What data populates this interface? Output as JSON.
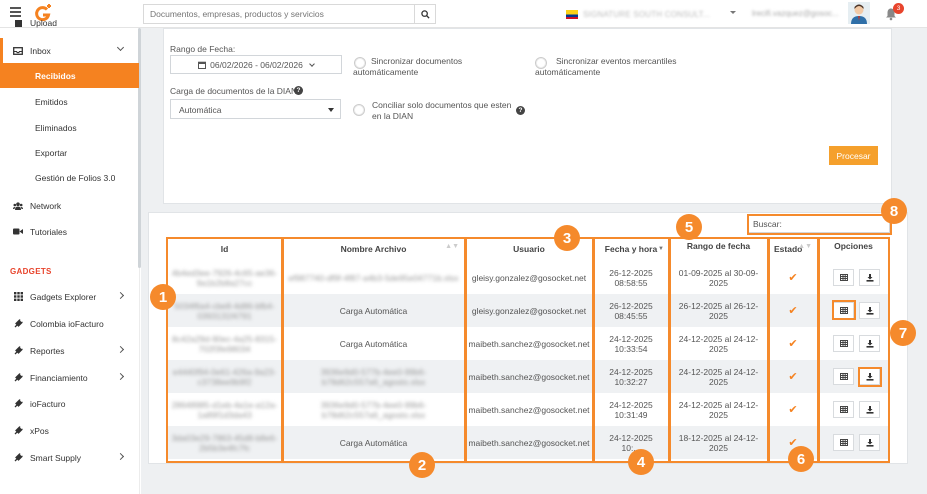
{
  "header": {
    "search_placeholder": "Documentos, empresas, productos y servicios",
    "company_name": "SIGNATURE SOUTH CONSULT...",
    "user_email": "lrecifi.vazquez@gosoc...",
    "notification_count": "3"
  },
  "sidebar": {
    "top_item_label": "Upload",
    "inbox": {
      "label": "Inbox",
      "subitems": [
        "Recibidos",
        "Emitidos",
        "Eliminados",
        "Exportar",
        "Gestión de Folios 3.0"
      ]
    },
    "items": [
      "Network",
      "Tutoriales"
    ],
    "gadgets_heading": "GADGETS",
    "gadgets": [
      "Gadgets Explorer",
      "Colombia ioFacturo",
      "Reportes",
      "Financiamiento",
      "ioFacturo",
      "xPos",
      "Smart Supply"
    ]
  },
  "form": {
    "date_range_label": "Rango de Fecha:",
    "date_range_value": "06/02/2026 - 06/02/2026",
    "sync_docs_label_1": "Sincronizar documentos",
    "sync_docs_label_2": "automáticamente",
    "sync_events_label_1": "Sincronizar eventos mercantiles",
    "sync_events_label_2": "automáticamente",
    "load_label": "Carga de documentos de la DIAN:",
    "load_value": "Automática",
    "reconcile_label_1": "Conciliar solo documentos que esten",
    "reconcile_label_2": "en la DIAN",
    "process_button": "Procesar"
  },
  "table": {
    "search_label": "Buscar:",
    "columns": [
      "Id",
      "Nombre Archivo",
      "Usuario",
      "Fecha y hora",
      "Rango de fecha",
      "Estado",
      "Opciones"
    ],
    "rows": [
      {
        "id": "4b4ed3ee-7926-4c65-ae36-9a1b2b8a27cc",
        "file_1": "ef987740-df9f-4f87-a4b3-5de95e04771b.xlsx",
        "file_2": "",
        "user": "gleisy.gonzalez@gosocket.net",
        "date": "26-12-2025",
        "time": "08:58:55",
        "range_1": "01-09-2025 al 30-09-",
        "range_2": "2025"
      },
      {
        "id": "5034f6a4-cbe8-4d86-bfb4-0393131f4791",
        "file_1": "Carga Automática",
        "file_2": "",
        "user": "gleisy.gonzalez@gosocket.net",
        "date": "26-12-2025",
        "time": "08:45:55",
        "range_1": "26-12-2025 al 26-12-",
        "range_2": "2025"
      },
      {
        "id": "8c42a29d-90ec-4a25-8315-702f3fe98034",
        "file_1": "Carga Automática",
        "file_2": "",
        "user": "maibeth.sanchez@gosocket.net",
        "date": "24-12-2025",
        "time": "10:33:54",
        "range_1": "24-12-2025 al 24-12-",
        "range_2": "2025"
      },
      {
        "id": "e4440f94-0e61-426a-9a23-c3738ee9b9f2",
        "file_1": "3936e9d0-577b-4ee0-99b6-",
        "file_2": "b78d62c557a6_agosto.xlsx",
        "user": "maibeth.sanchez@gosocket.net",
        "date": "24-12-2025",
        "time": "10:32:27",
        "range_1": "24-12-2025 al 24-12-",
        "range_2": "2025"
      },
      {
        "id": "28648985-d1eb-4a1e-a12a-1a89f1d3da43",
        "file_1": "3936e9d0-577b-4ee0-99b6-",
        "file_2": "b78d62c557a6_agosto.xlsx",
        "user": "maibeth.sanchez@gosocket.net",
        "date": "24-12-2025",
        "time": "10:31:49",
        "range_1": "24-12-2025 al 24-12-",
        "range_2": "2025"
      },
      {
        "id": "3da03e29-7863-45d8-b8e6-2b5b3e4fc7fc",
        "file_1": "Carga Automática",
        "file_2": "",
        "user": "maibeth.sanchez@gosocket.net",
        "date": "24-12-2025",
        "time": "10:...",
        "range_1": "18-12-2025 al 24-12-",
        "range_2": "2025"
      }
    ]
  },
  "annotations": [
    "1",
    "2",
    "3",
    "4",
    "5",
    "6",
    "7",
    "8"
  ],
  "colors": {
    "accent": "#f58220",
    "annotation": "#f58a2c",
    "badge": "#e8442c"
  }
}
